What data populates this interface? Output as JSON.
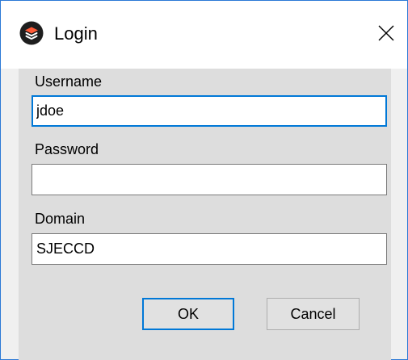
{
  "window": {
    "title": "Login",
    "icon": "app-logo-icon",
    "close_icon": "close-icon"
  },
  "form": {
    "username": {
      "label": "Username",
      "value": "jdoe",
      "focused": true
    },
    "password": {
      "label": "Password",
      "value": ""
    },
    "domain": {
      "label": "Domain",
      "value": "SJECCD"
    }
  },
  "buttons": {
    "ok_label": "OK",
    "cancel_label": "Cancel"
  },
  "colors": {
    "accent": "#0078d7",
    "window_border": "#2b79d6",
    "client_bg": "#dddddd",
    "button_bg": "#e1e1e1",
    "app_icon_bg": "#1e1e1e",
    "app_icon_fg": "#ff5a36"
  }
}
